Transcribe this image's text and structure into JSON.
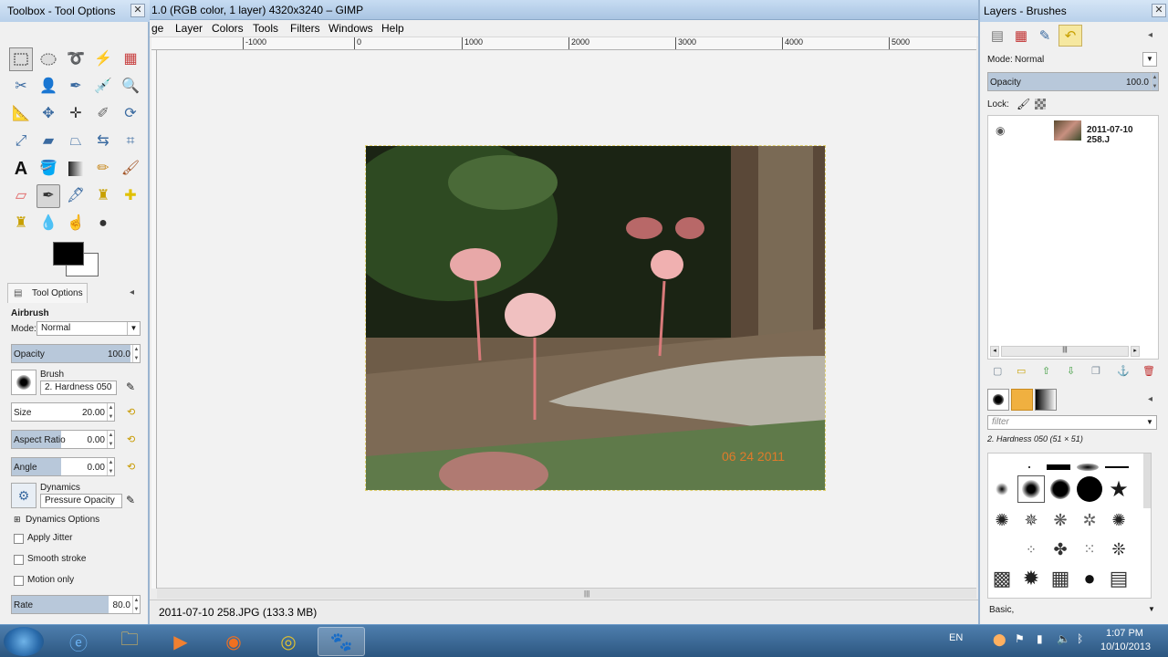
{
  "image_window": {
    "title": "1.0 (RGB color, 1 layer) 4320x3240 – GIMP",
    "menu": [
      "ge",
      "Layer",
      "Colors",
      "Tools",
      "Filters",
      "Windows",
      "Help"
    ],
    "ruler_labels": [
      "-1000",
      "0",
      "1000",
      "2000",
      "3000",
      "4000",
      "5000"
    ],
    "status": "2011-07-10 258.JPG (133.3 MB)",
    "photo_date_stamp": "06 24 2011"
  },
  "toolbox": {
    "title": "Toolbox - Tool Options",
    "close": "✕",
    "tools": [
      "rect-select",
      "ellipse-select",
      "free-select",
      "fuzzy-select",
      "color-select",
      "scissors-select",
      "foreground-select",
      "paths",
      "color-picker",
      "zoom",
      "measure",
      "move",
      "align",
      "crop",
      "rotate",
      "scale",
      "shear",
      "perspective",
      "flip",
      "cage",
      "text",
      "bucket-fill",
      "blend",
      "pencil",
      "paintbrush",
      "eraser",
      "airbrush",
      "ink",
      "clone",
      "heal",
      "perspective-clone",
      "blur",
      "smudge",
      "dodge-burn"
    ],
    "active_tool": "airbrush"
  },
  "tool_options": {
    "tab_label": "Tool Options",
    "tool_name": "Airbrush",
    "mode_label": "Mode:",
    "mode_value": "Normal",
    "opacity": {
      "label": "Opacity",
      "value": "100.0",
      "fraction": 1.0
    },
    "brush_label": "Brush",
    "brush_value": "2. Hardness 050",
    "size": {
      "label": "Size",
      "value": "20.00",
      "fraction": 0.0
    },
    "aspect_ratio": {
      "label": "Aspect Ratio",
      "value": "0.00",
      "fraction": 0.5
    },
    "angle": {
      "label": "Angle",
      "value": "0.00",
      "fraction": 0.5
    },
    "dynamics_label": "Dynamics",
    "dynamics_value": "Pressure Opacity",
    "dynamics_options": "Dynamics Options",
    "apply_jitter": "Apply Jitter",
    "smooth_stroke": "Smooth stroke",
    "motion_only": "Motion only",
    "rate": {
      "label": "Rate",
      "value": "80.0",
      "fraction": 0.8
    }
  },
  "dock": {
    "title": "Layers - Brushes",
    "mode_label": "Mode:",
    "mode_value": "Normal",
    "opacity_label": "Opacity",
    "opacity_value": "100.0",
    "opacity_fraction": 1.0,
    "lock_label": "Lock:",
    "layer_name": "2011-07-10 258.J",
    "filter_placeholder": "filter",
    "brush_title": "2. Hardness 050 (51 × 51)",
    "brush_preset": "Basic,"
  },
  "taskbar": {
    "lang": "EN",
    "time": "1:07 PM",
    "date": "10/10/2013"
  }
}
